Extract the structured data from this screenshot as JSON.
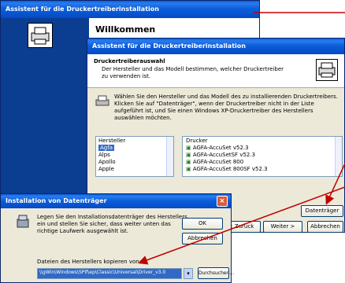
{
  "wizard_back": {
    "title": "Assistent für die Druckertreiberinstallation",
    "heading": "Willkommen"
  },
  "wizard_front": {
    "title": "Assistent für die Druckertreiberinstallation",
    "section_title": "Druckertreiberauswahl",
    "section_subtitle": "Der Hersteller und das Modell bestimmen, welcher Druckertreiber zu verwenden ist.",
    "instructions": "Wählen Sie den Hersteller und das Modell des zu installierenden Druckertreibers. Klicken Sie auf \"Datenträger\", wenn der Druckertreiber nicht in der Liste aufgeführt ist, und Sie einen Windows XP-Druckertreiber des Herstellers auswählen möchten.",
    "manufacturer_header": "Hersteller",
    "manufacturers": [
      "Agfa",
      "Alps",
      "Apollo",
      "Apple"
    ],
    "printer_header": "Drucker",
    "printers": [
      "AGFA-AccuSet v52.3",
      "AGFA-AccuSetSF v52.3",
      "AGFA-AccuSet 800",
      "AGFA-AccuSet 800SF v52.3"
    ],
    "have_disk_label": "Datenträger",
    "back_label": "< Zurück",
    "next_label": "Weiter >",
    "cancel_label": "Abbrechen"
  },
  "install_dialog": {
    "title": "Installation von Datenträger",
    "message": "Legen Sie den Installationsdatenträger des Herstellers ein und stellen Sie sicher, dass weiter unten das richtige Laufwerk ausgewählt ist.",
    "ok_label": "OK",
    "cancel_label": "Abbrechen",
    "copy_label": "Dateien des Herstellers kopieren von:",
    "path_value": "\\\\gWin\\Windows\\SPIf\\ep\\Classic\\Universal\\Driver_v3.0",
    "browse_label": "Durchsuchen...",
    "close_glyph": "×"
  },
  "colors": {
    "annotation_arrow": "#c00000",
    "titlebar": "#0a5fd8",
    "window_bg": "#ECE9D8"
  }
}
